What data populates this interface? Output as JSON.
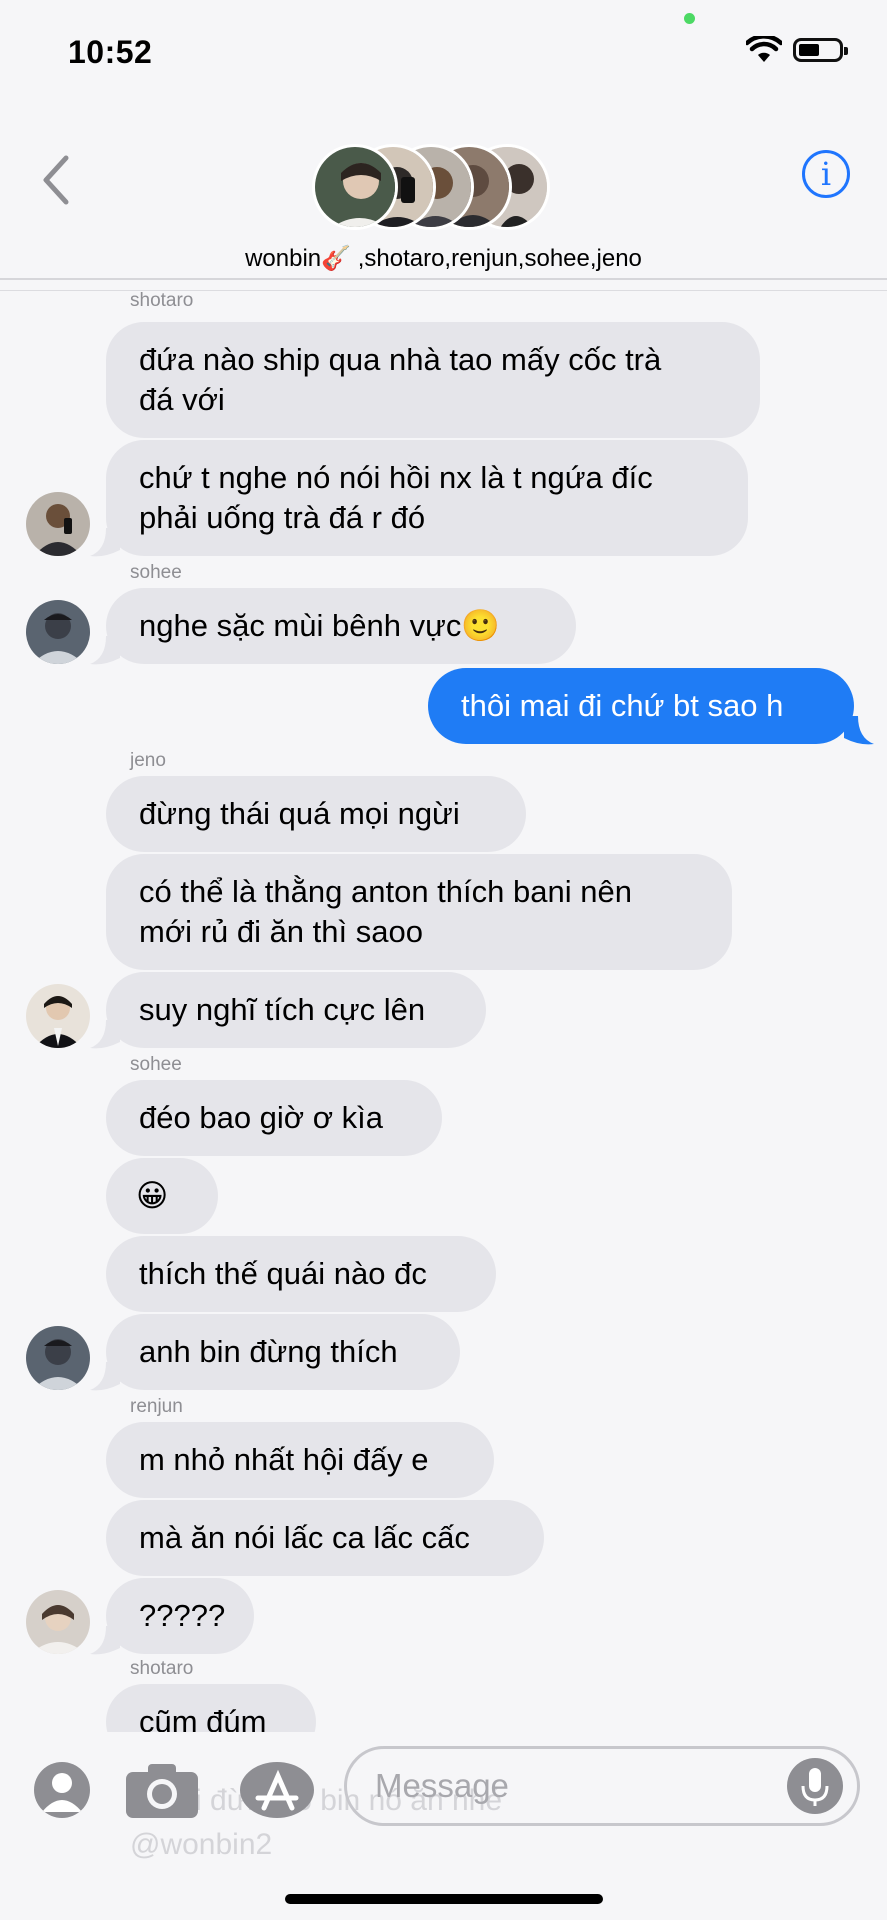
{
  "status_bar": {
    "time": "10:52"
  },
  "header": {
    "group_names": "wonbin🎸 ,shotaro,renjun,sohee,jeno",
    "info_label": "i"
  },
  "messages": [
    {
      "sender": "shotaro",
      "lines": [
        "đứa nào ship qua nhà tao mấy cốc trà",
        "đá với"
      ]
    },
    {
      "lines": [
        "chứ t nghe nó nói hồi nx là t ngứa đíc",
        "phải uống trà đá r đó"
      ]
    },
    {
      "sender": "sohee",
      "lines": [
        "nghe sặc mùi bênh vực🙂"
      ]
    },
    {
      "lines": [
        "thôi mai đi chứ bt sao h"
      ],
      "outgoing": true
    },
    {
      "sender": "jeno",
      "lines": [
        "đừng thái quá mọi ngừi"
      ]
    },
    {
      "lines": [
        "có thể là thằng anton thích bani nên",
        "mới rủ đi ăn thì saoo"
      ]
    },
    {
      "lines": [
        "suy nghĩ tích cực lên"
      ]
    },
    {
      "sender": "sohee",
      "lines": [
        "đéo bao giờ ơ kìa"
      ]
    },
    {
      "lines": [
        "😀"
      ]
    },
    {
      "lines": [
        "thích thế quái nào đc"
      ]
    },
    {
      "lines": [
        "anh bin đừng thích"
      ]
    },
    {
      "sender": "renjun",
      "lines": [
        "m nhỏ nhất hội đấy e"
      ]
    },
    {
      "lines": [
        "mà ăn nói lấc ca lấc cấc"
      ]
    },
    {
      "lines": [
        "?????"
      ]
    },
    {
      "sender": "shotaro",
      "lines": [
        "cũm đúm"
      ]
    }
  ],
  "ghost_text": {
    "line1": "ai hỏi đừng lo bin nó ăn nhé",
    "line2": "@wonbin2"
  },
  "input_bar": {
    "placeholder": "Message"
  },
  "colors": {
    "accent": "#1f7cf5",
    "bubble_incoming": "#e5e5ea",
    "background": "#f6f6f8"
  }
}
